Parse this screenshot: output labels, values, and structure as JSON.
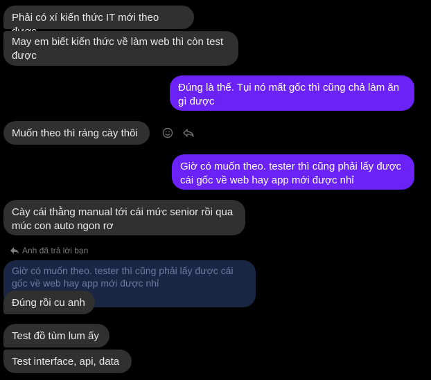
{
  "colors": {
    "background": "#000000",
    "incoming_bubble": "#303030",
    "outgoing_bubble": "#6a22f6",
    "quoted_bubble": "#1a2744"
  },
  "messages": [
    {
      "id": "m1",
      "sender": "other",
      "text": "Phải có xí kiến thức IT mới theo được"
    },
    {
      "id": "m2",
      "sender": "other",
      "text": "May em biết kiến thức về làm web thì còn test được"
    },
    {
      "id": "m3",
      "sender": "me",
      "text": "Đúng là thế. Tụi nó mất gốc thì cũng chả làm ăn gì được"
    },
    {
      "id": "m4",
      "sender": "other",
      "text": "Muốn theo thì ráng cày thôi"
    },
    {
      "id": "m5",
      "sender": "me",
      "text": "Giờ có muốn theo. tester thì cũng phải lấy được cái gốc về web hay app mới được nhỉ"
    },
    {
      "id": "m6",
      "sender": "other",
      "text": "Cày cái thằng manual tới cái mức senior rồi qua múc con auto ngon rơ"
    },
    {
      "id": "m7",
      "sender": "other",
      "text": "Đúng rồi cu anh"
    },
    {
      "id": "m8",
      "sender": "other",
      "text": "Test đồ tùm lum ấy"
    },
    {
      "id": "m9",
      "sender": "other",
      "text": "Test interface, api, data"
    }
  ],
  "reply": {
    "header": "Anh đã trả lời bạn",
    "quoted_text": "Giờ có muốn theo. tester thì cũng phải lấy được cái gốc về web hay app mới được nhỉ",
    "header_icon": "reply-arrow-icon"
  },
  "hover_actions": [
    {
      "icon": "emoji-react-icon"
    },
    {
      "icon": "reply-icon"
    }
  ]
}
